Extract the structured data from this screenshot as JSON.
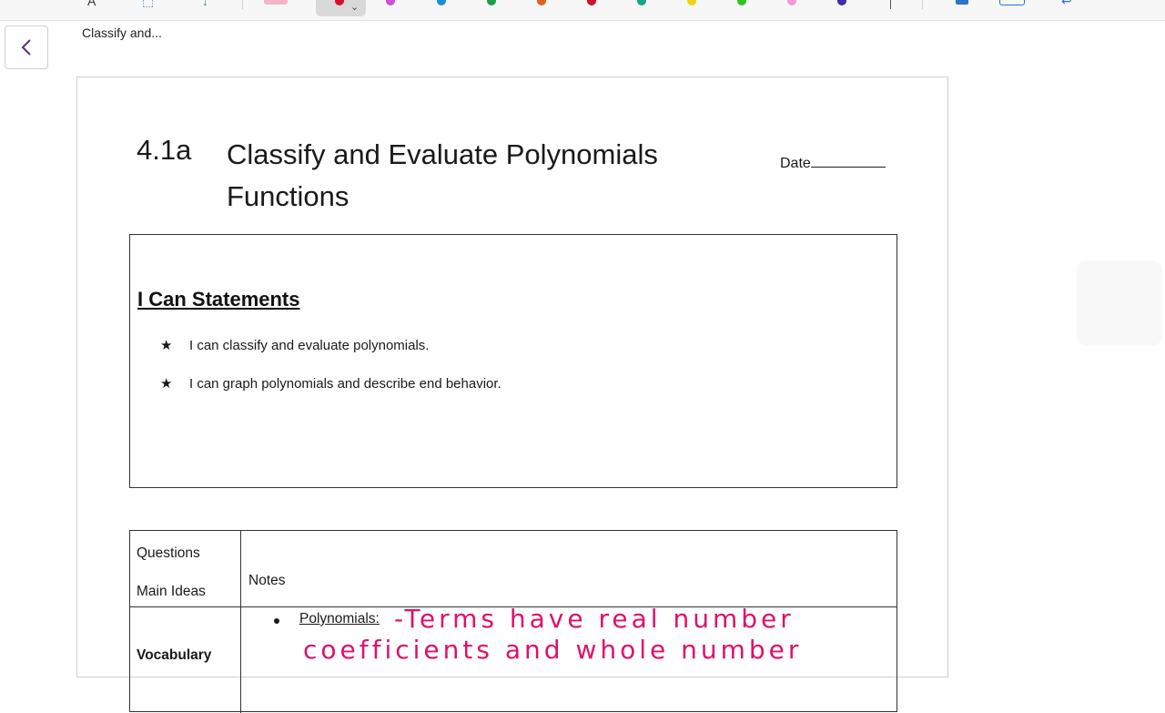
{
  "toolbar": {
    "pen_colors": [
      "#7a1fa2",
      "#d04fd6",
      "#1f8fd1",
      "#1aa04a",
      "#e0611a",
      "#d2102e",
      "#19a38b",
      "#f2d313",
      "#33c11f",
      "#f29ad9",
      "#3f2ca8"
    ],
    "selected_pen_color": "#d2102e",
    "highlight_colors": [
      "#f2d313",
      "#33c11f",
      "#f29ad9"
    ]
  },
  "nav": {
    "breadcrumb": "Classify and..."
  },
  "page": {
    "lesson_number": "4.1a",
    "lesson_title": "Classify and Evaluate Polynomials Functions",
    "date_label": "Date",
    "ican": {
      "heading": "I Can Statements",
      "items": [
        "I can classify and evaluate polynomials.",
        "I can graph polynomials and describe end behavior."
      ],
      "bullet_glyph": "★"
    },
    "table": {
      "col1_header_line1": "Questions",
      "col1_header_line2": "Main Ideas",
      "col2_header": "Notes",
      "vocab_label": "Vocabulary",
      "polynomials_label": "Polynomials:",
      "handwriting_line1": "-Terms have real number",
      "handwriting_line2": "coefficients and whole number"
    }
  },
  "colors": {
    "ink": "#e0106a",
    "accent": "#5b2d8e"
  }
}
